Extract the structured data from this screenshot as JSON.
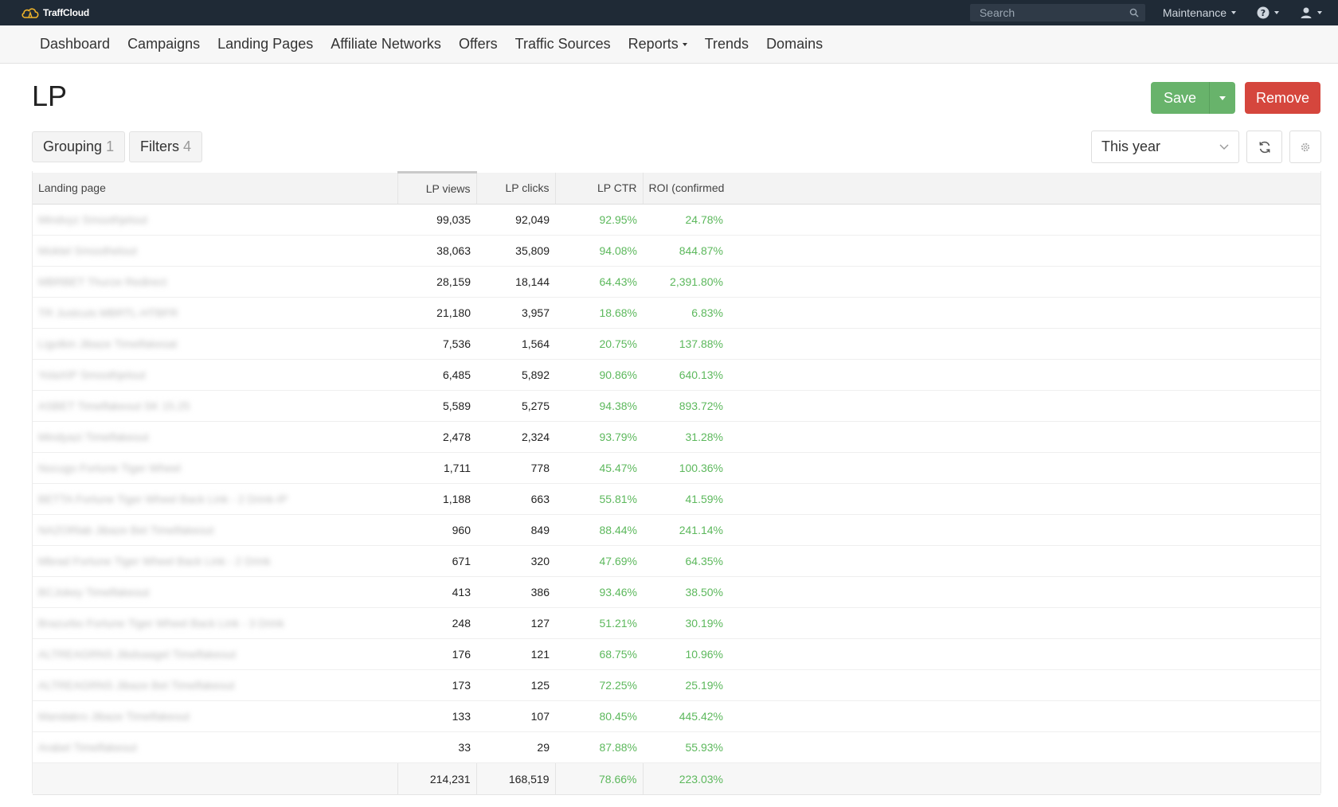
{
  "topbar": {
    "brand": "TraffCloud",
    "search_placeholder": "Search",
    "maintenance_label": "Maintenance"
  },
  "nav": {
    "items": [
      "Dashboard",
      "Campaigns",
      "Landing Pages",
      "Affiliate Networks",
      "Offers",
      "Traffic Sources",
      "Reports",
      "Trends",
      "Domains"
    ]
  },
  "header": {
    "title": "LP",
    "save_label": "Save",
    "remove_label": "Remove"
  },
  "toolbar": {
    "grouping_label": "Grouping",
    "grouping_count": "1",
    "filters_label": "Filters",
    "filters_count": "4",
    "date_range": "This year"
  },
  "table": {
    "columns": [
      "Landing page",
      "LP views",
      "LP clicks",
      "LP CTR",
      "ROI (confirmed"
    ],
    "rows": [
      {
        "name": "Mindvyz Smoothjelout",
        "views": "99,035",
        "clicks": "92,049",
        "ctr": "92.95%",
        "roi": "24.78%"
      },
      {
        "name": "Moktel Smoothelout",
        "views": "38,063",
        "clicks": "35,809",
        "ctr": "94.08%",
        "roi": "844.87%"
      },
      {
        "name": "MBRBET Thurze Redirect",
        "views": "28,159",
        "clicks": "18,144",
        "ctr": "64.43%",
        "roi": "2,391.80%"
      },
      {
        "name": "TR Justcuis MBRTL-HTBFR",
        "views": "21,180",
        "clicks": "3,957",
        "ctr": "18.68%",
        "roi": "6.83%"
      },
      {
        "name": "Ligolkin Jibaze Timelfakesat",
        "views": "7,536",
        "clicks": "1,564",
        "ctr": "20.75%",
        "roi": "137.88%"
      },
      {
        "name": "YolaXIP Smoothjelout",
        "views": "6,485",
        "clicks": "5,892",
        "ctr": "90.86%",
        "roi": "640.13%"
      },
      {
        "name": "ASBET Timelfakeout SK 15.25",
        "views": "5,589",
        "clicks": "5,275",
        "ctr": "94.38%",
        "roi": "893.72%"
      },
      {
        "name": "Mindyazi Timelfakeout",
        "views": "2,478",
        "clicks": "2,324",
        "ctr": "93.79%",
        "roi": "31.28%"
      },
      {
        "name": "Nocugo Fortune Tiger Wheel",
        "views": "1,711",
        "clicks": "778",
        "ctr": "45.47%",
        "roi": "100.36%"
      },
      {
        "name": "BETTA Fortune Tiger Wheel Back Link - 2 Drink-IP",
        "views": "1,188",
        "clicks": "663",
        "ctr": "55.81%",
        "roi": "41.59%"
      },
      {
        "name": "NAZORlab Jibaze Bet Timelfakeout",
        "views": "960",
        "clicks": "849",
        "ctr": "88.44%",
        "roi": "241.14%"
      },
      {
        "name": "Mbrad Fortune Tiger Wheel Back Link - 2 Drink",
        "views": "671",
        "clicks": "320",
        "ctr": "47.69%",
        "roi": "64.35%"
      },
      {
        "name": "BCJokey Timelfakeout",
        "views": "413",
        "clicks": "386",
        "ctr": "93.46%",
        "roi": "38.50%"
      },
      {
        "name": "Brazurbo Fortune Tiger Wheel Back Link - 3 Drink",
        "views": "248",
        "clicks": "127",
        "ctr": "51.21%",
        "roi": "30.19%"
      },
      {
        "name": "ALTREAGRNS Jibdsaagel Timelfakeout",
        "views": "176",
        "clicks": "121",
        "ctr": "68.75%",
        "roi": "10.96%"
      },
      {
        "name": "ALTREAGRNS Jibaze Bet Timelfakeout",
        "views": "173",
        "clicks": "125",
        "ctr": "72.25%",
        "roi": "25.19%"
      },
      {
        "name": "Mandakro Jibaze Timelfakeout",
        "views": "133",
        "clicks": "107",
        "ctr": "80.45%",
        "roi": "445.42%"
      },
      {
        "name": "Arabel Timelfakeout",
        "views": "33",
        "clicks": "29",
        "ctr": "87.88%",
        "roi": "55.93%"
      }
    ],
    "totals": {
      "views": "214,231",
      "clicks": "168,519",
      "ctr": "78.66%",
      "roi": "223.03%"
    }
  },
  "colors": {
    "topbar": "#1f2a36",
    "save": "#68b36b",
    "remove": "#d5463d",
    "positive": "#5cb85c"
  }
}
